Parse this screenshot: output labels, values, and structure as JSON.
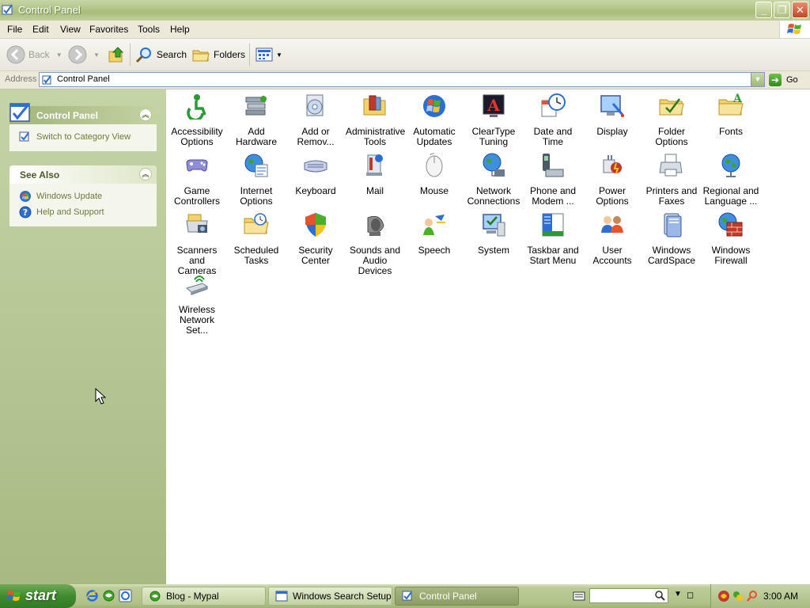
{
  "window": {
    "title": "Control Panel"
  },
  "menu": [
    "File",
    "Edit",
    "View",
    "Favorites",
    "Tools",
    "Help"
  ],
  "toolbar": {
    "back": "Back",
    "search": "Search",
    "folders": "Folders"
  },
  "address": {
    "label": "Address",
    "value": "Control Panel",
    "go": "Go"
  },
  "taskpane": {
    "control_panel": {
      "title": "Control Panel",
      "switch_link": "Switch to Category View"
    },
    "see_also": {
      "title": "See Also",
      "links": [
        "Windows Update",
        "Help and Support"
      ]
    }
  },
  "items": [
    {
      "label": "Accessibility\nOptions",
      "icon": "accessibility-icon"
    },
    {
      "label": "Add Hardware",
      "icon": "add-hardware-icon"
    },
    {
      "label": "Add or\nRemov...",
      "icon": "add-remove-programs-icon"
    },
    {
      "label": "Administrative\nTools",
      "icon": "administrative-tools-icon"
    },
    {
      "label": "Automatic\nUpdates",
      "icon": "automatic-updates-icon"
    },
    {
      "label": "ClearType\nTuning",
      "icon": "cleartype-icon"
    },
    {
      "label": "Date and Time",
      "icon": "date-time-icon"
    },
    {
      "label": "Display",
      "icon": "display-icon"
    },
    {
      "label": "Folder Options",
      "icon": "folder-options-icon"
    },
    {
      "label": "Fonts",
      "icon": "fonts-icon"
    },
    {
      "label": "Game\nControllers",
      "icon": "game-controllers-icon"
    },
    {
      "label": "Internet\nOptions",
      "icon": "internet-options-icon"
    },
    {
      "label": "Keyboard",
      "icon": "keyboard-icon"
    },
    {
      "label": "Mail",
      "icon": "mail-icon"
    },
    {
      "label": "Mouse",
      "icon": "mouse-icon"
    },
    {
      "label": "Network\nConnections",
      "icon": "network-connections-icon"
    },
    {
      "label": "Phone and\nModem ...",
      "icon": "phone-modem-icon"
    },
    {
      "label": "Power Options",
      "icon": "power-options-icon"
    },
    {
      "label": "Printers and\nFaxes",
      "icon": "printers-faxes-icon"
    },
    {
      "label": "Regional and\nLanguage ...",
      "icon": "regional-language-icon"
    },
    {
      "label": "Scanners and\nCameras",
      "icon": "scanners-cameras-icon"
    },
    {
      "label": "Scheduled\nTasks",
      "icon": "scheduled-tasks-icon"
    },
    {
      "label": "Security\nCenter",
      "icon": "security-center-icon"
    },
    {
      "label": "Sounds and\nAudio Devices",
      "icon": "sounds-audio-icon"
    },
    {
      "label": "Speech",
      "icon": "speech-icon"
    },
    {
      "label": "System",
      "icon": "system-icon"
    },
    {
      "label": "Taskbar and\nStart Menu",
      "icon": "taskbar-start-menu-icon"
    },
    {
      "label": "User Accounts",
      "icon": "user-accounts-icon"
    },
    {
      "label": "Windows\nCardSpace",
      "icon": "cardspace-icon"
    },
    {
      "label": "Windows\nFirewall",
      "icon": "firewall-icon"
    },
    {
      "label": "Wireless\nNetwork Set...",
      "icon": "wireless-network-icon"
    }
  ],
  "taskbar": {
    "start": "start",
    "tasks": [
      "Blog - Mypal",
      "Windows Search Setup",
      "Control Panel"
    ],
    "clock": "3:00 AM"
  }
}
